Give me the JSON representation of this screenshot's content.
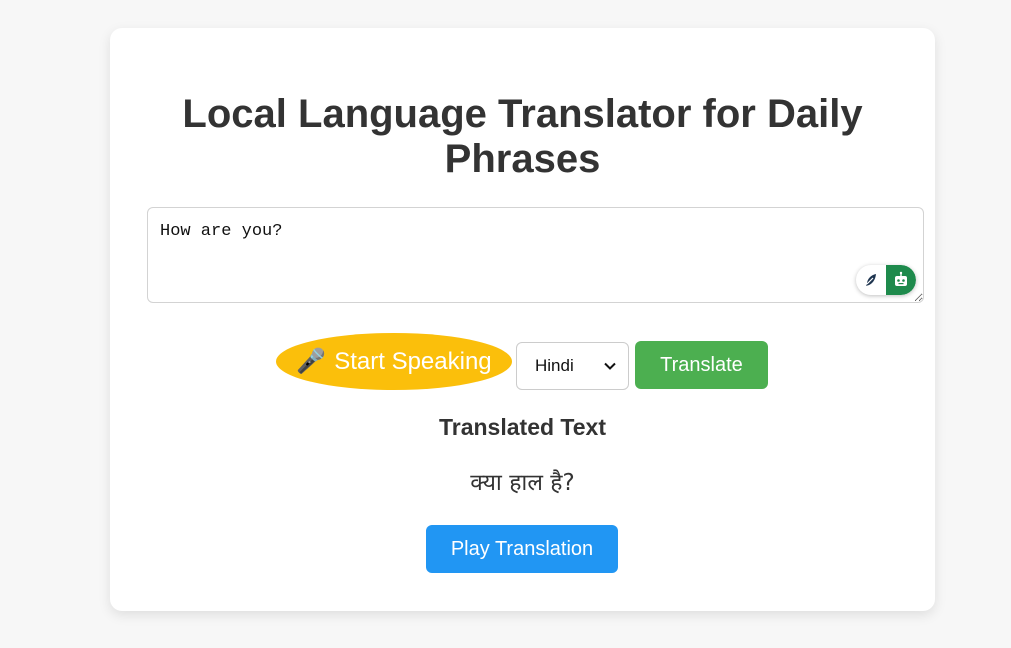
{
  "page": {
    "title": "Local Language Translator for Daily Phrases"
  },
  "input": {
    "value": "How are you?"
  },
  "controls": {
    "speak_icon": "🎤",
    "speak_label": "Start Speaking",
    "language_selected": "Hindi",
    "translate_label": "Translate"
  },
  "result": {
    "heading": "Translated Text",
    "text": "क्या हाल है?",
    "play_label": "Play Translation"
  },
  "icons": {
    "extension_left": "feather-icon",
    "extension_right": "robot-icon"
  },
  "colors": {
    "speak_button": "#fbbf0b",
    "translate_button": "#4caf50",
    "play_button": "#2196f3",
    "extension_green": "#1e8a4c"
  }
}
